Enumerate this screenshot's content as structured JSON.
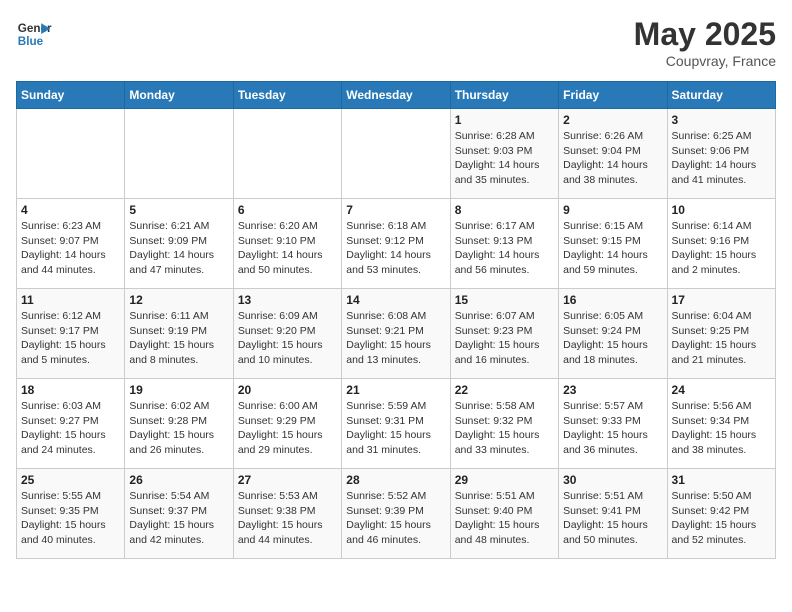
{
  "header": {
    "logo_general": "General",
    "logo_blue": "Blue",
    "month": "May 2025",
    "location": "Coupvray, France"
  },
  "days_of_week": [
    "Sunday",
    "Monday",
    "Tuesday",
    "Wednesday",
    "Thursday",
    "Friday",
    "Saturday"
  ],
  "weeks": [
    [
      {
        "day": "",
        "detail": ""
      },
      {
        "day": "",
        "detail": ""
      },
      {
        "day": "",
        "detail": ""
      },
      {
        "day": "",
        "detail": ""
      },
      {
        "day": "1",
        "detail": "Sunrise: 6:28 AM\nSunset: 9:03 PM\nDaylight: 14 hours\nand 35 minutes."
      },
      {
        "day": "2",
        "detail": "Sunrise: 6:26 AM\nSunset: 9:04 PM\nDaylight: 14 hours\nand 38 minutes."
      },
      {
        "day": "3",
        "detail": "Sunrise: 6:25 AM\nSunset: 9:06 PM\nDaylight: 14 hours\nand 41 minutes."
      }
    ],
    [
      {
        "day": "4",
        "detail": "Sunrise: 6:23 AM\nSunset: 9:07 PM\nDaylight: 14 hours\nand 44 minutes."
      },
      {
        "day": "5",
        "detail": "Sunrise: 6:21 AM\nSunset: 9:09 PM\nDaylight: 14 hours\nand 47 minutes."
      },
      {
        "day": "6",
        "detail": "Sunrise: 6:20 AM\nSunset: 9:10 PM\nDaylight: 14 hours\nand 50 minutes."
      },
      {
        "day": "7",
        "detail": "Sunrise: 6:18 AM\nSunset: 9:12 PM\nDaylight: 14 hours\nand 53 minutes."
      },
      {
        "day": "8",
        "detail": "Sunrise: 6:17 AM\nSunset: 9:13 PM\nDaylight: 14 hours\nand 56 minutes."
      },
      {
        "day": "9",
        "detail": "Sunrise: 6:15 AM\nSunset: 9:15 PM\nDaylight: 14 hours\nand 59 minutes."
      },
      {
        "day": "10",
        "detail": "Sunrise: 6:14 AM\nSunset: 9:16 PM\nDaylight: 15 hours\nand 2 minutes."
      }
    ],
    [
      {
        "day": "11",
        "detail": "Sunrise: 6:12 AM\nSunset: 9:17 PM\nDaylight: 15 hours\nand 5 minutes."
      },
      {
        "day": "12",
        "detail": "Sunrise: 6:11 AM\nSunset: 9:19 PM\nDaylight: 15 hours\nand 8 minutes."
      },
      {
        "day": "13",
        "detail": "Sunrise: 6:09 AM\nSunset: 9:20 PM\nDaylight: 15 hours\nand 10 minutes."
      },
      {
        "day": "14",
        "detail": "Sunrise: 6:08 AM\nSunset: 9:21 PM\nDaylight: 15 hours\nand 13 minutes."
      },
      {
        "day": "15",
        "detail": "Sunrise: 6:07 AM\nSunset: 9:23 PM\nDaylight: 15 hours\nand 16 minutes."
      },
      {
        "day": "16",
        "detail": "Sunrise: 6:05 AM\nSunset: 9:24 PM\nDaylight: 15 hours\nand 18 minutes."
      },
      {
        "day": "17",
        "detail": "Sunrise: 6:04 AM\nSunset: 9:25 PM\nDaylight: 15 hours\nand 21 minutes."
      }
    ],
    [
      {
        "day": "18",
        "detail": "Sunrise: 6:03 AM\nSunset: 9:27 PM\nDaylight: 15 hours\nand 24 minutes."
      },
      {
        "day": "19",
        "detail": "Sunrise: 6:02 AM\nSunset: 9:28 PM\nDaylight: 15 hours\nand 26 minutes."
      },
      {
        "day": "20",
        "detail": "Sunrise: 6:00 AM\nSunset: 9:29 PM\nDaylight: 15 hours\nand 29 minutes."
      },
      {
        "day": "21",
        "detail": "Sunrise: 5:59 AM\nSunset: 9:31 PM\nDaylight: 15 hours\nand 31 minutes."
      },
      {
        "day": "22",
        "detail": "Sunrise: 5:58 AM\nSunset: 9:32 PM\nDaylight: 15 hours\nand 33 minutes."
      },
      {
        "day": "23",
        "detail": "Sunrise: 5:57 AM\nSunset: 9:33 PM\nDaylight: 15 hours\nand 36 minutes."
      },
      {
        "day": "24",
        "detail": "Sunrise: 5:56 AM\nSunset: 9:34 PM\nDaylight: 15 hours\nand 38 minutes."
      }
    ],
    [
      {
        "day": "25",
        "detail": "Sunrise: 5:55 AM\nSunset: 9:35 PM\nDaylight: 15 hours\nand 40 minutes."
      },
      {
        "day": "26",
        "detail": "Sunrise: 5:54 AM\nSunset: 9:37 PM\nDaylight: 15 hours\nand 42 minutes."
      },
      {
        "day": "27",
        "detail": "Sunrise: 5:53 AM\nSunset: 9:38 PM\nDaylight: 15 hours\nand 44 minutes."
      },
      {
        "day": "28",
        "detail": "Sunrise: 5:52 AM\nSunset: 9:39 PM\nDaylight: 15 hours\nand 46 minutes."
      },
      {
        "day": "29",
        "detail": "Sunrise: 5:51 AM\nSunset: 9:40 PM\nDaylight: 15 hours\nand 48 minutes."
      },
      {
        "day": "30",
        "detail": "Sunrise: 5:51 AM\nSunset: 9:41 PM\nDaylight: 15 hours\nand 50 minutes."
      },
      {
        "day": "31",
        "detail": "Sunrise: 5:50 AM\nSunset: 9:42 PM\nDaylight: 15 hours\nand 52 minutes."
      }
    ]
  ]
}
